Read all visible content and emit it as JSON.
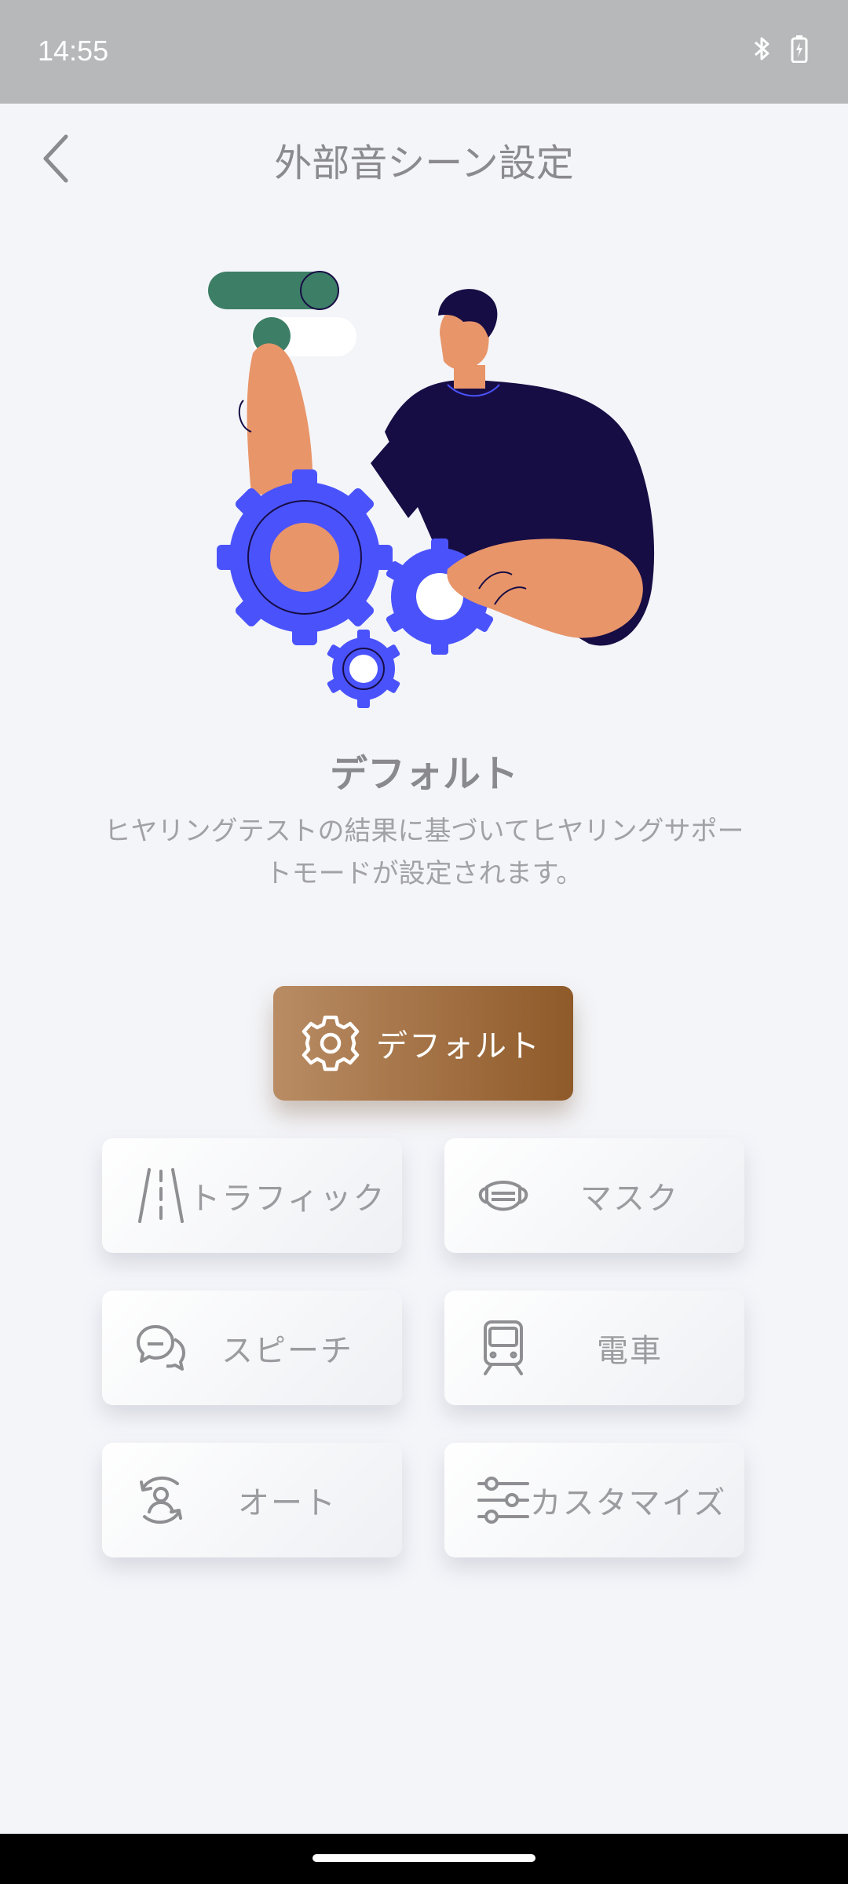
{
  "status": {
    "time": "14:55"
  },
  "header": {
    "title": "外部音シーン設定"
  },
  "scene": {
    "title": "デフォルト",
    "description": "ヒヤリングテストの結果に基づいてヒヤリングサポートモードが設定されます。"
  },
  "modes": {
    "default": "デフォルト",
    "traffic": "トラフィック",
    "mask": "マスク",
    "speech": "スピーチ",
    "train": "電車",
    "auto": "オート",
    "customize": "カスタマイズ"
  },
  "selected_mode": "default",
  "colors": {
    "accent_start": "#b98c64",
    "accent_end": "#8f5a29",
    "illus_blue": "#4a53fb",
    "illus_navy": "#170d45",
    "illus_skin": "#e8956a",
    "illus_green": "#3d7e66"
  },
  "icons": {
    "default": "gear-icon",
    "traffic": "road-icon",
    "mask": "mask-icon",
    "speech": "chat-bubbles-icon",
    "train": "train-icon",
    "auto": "auto-rotate-person-icon",
    "customize": "sliders-icon"
  }
}
